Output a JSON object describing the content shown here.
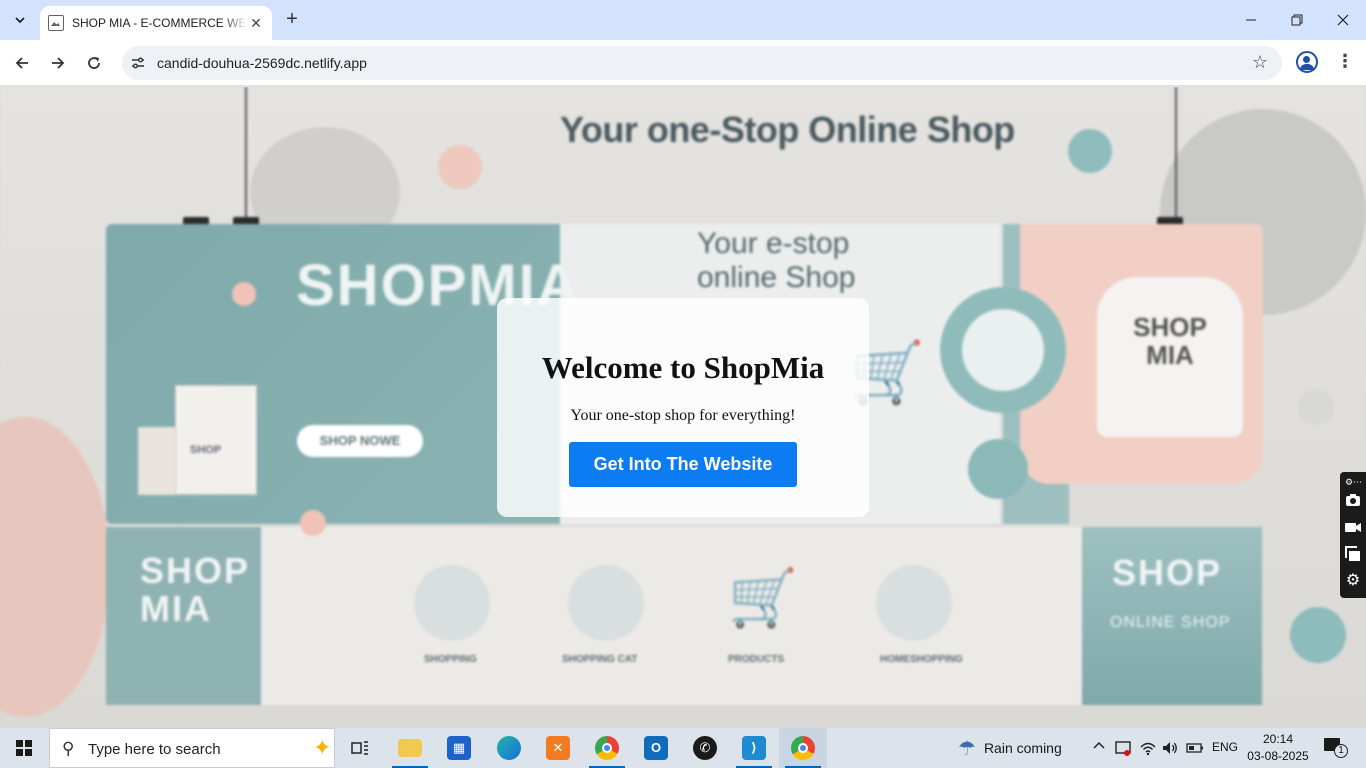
{
  "browser": {
    "tab_title": "SHOP MIA - E-COMMERCE WEBSITE",
    "new_tab_label": "+",
    "url": "candid-douhua-2569dc.netlify.app"
  },
  "hero_image": {
    "heading": "Your one-Stop Online Shop",
    "brand_large": "SHOPMIA",
    "tagline": "Your e-stop online Shop",
    "shop_now_button": "SHOP NOWE",
    "bag_label": "SHOP",
    "hoodie_text": "SHOP MIA",
    "bottom_left_brand": "SHOP MIA",
    "bottom_right_brand": "SHOP",
    "bottom_right_sub": "ONLINE SHOP",
    "categories": [
      "SHOPPING",
      "SHOPPING CAT",
      "PRODUCTS",
      "HOMESHOPPING"
    ]
  },
  "welcome": {
    "title": "Welcome to ShopMia",
    "subtitle": "Your one-stop shop for everything!",
    "cta_label": "Get Into The Website",
    "cta_color": "#0d7cf2"
  },
  "taskbar": {
    "search_placeholder": "Type here to search",
    "weather": "Rain coming",
    "language": "ENG",
    "time": "20:14",
    "date": "03-08-2025",
    "notification_count": "1",
    "apps": [
      "task-view",
      "file-explorer",
      "microsoft-store",
      "edge",
      "xampp",
      "chrome",
      "outlook",
      "whatsapp",
      "vscode",
      "chrome-active"
    ]
  }
}
